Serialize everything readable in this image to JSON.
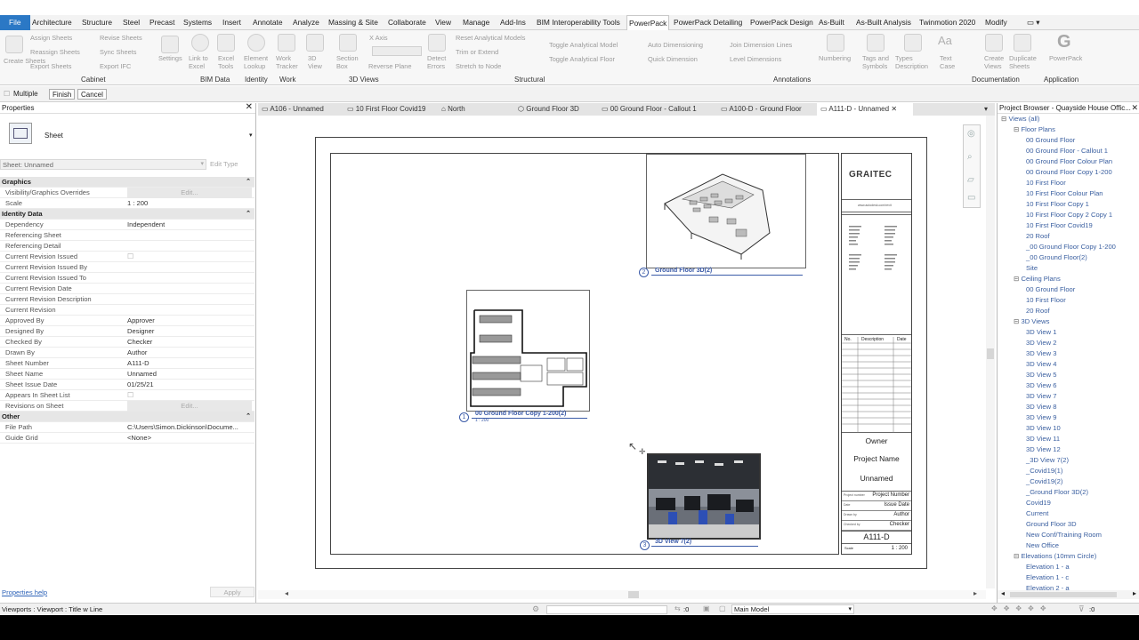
{
  "menu_tabs": [
    "File",
    "Architecture",
    "Structure",
    "Steel",
    "Precast",
    "Systems",
    "Insert",
    "Annotate",
    "Analyze",
    "Massing & Site",
    "Collaborate",
    "View",
    "Manage",
    "Add-Ins",
    "BIM Interoperability Tools",
    "PowerPack",
    "PowerPack Detailing",
    "PowerPack Design",
    "As-Built",
    "As-Built Analysis",
    "Twinmotion 2020",
    "Modify"
  ],
  "ribbon": {
    "cabinet_items": [
      "Assign Sheets",
      "Reassign Sheets",
      "Export Sheets",
      "Revise Sheets",
      "Sync Sheets",
      "Export IFC"
    ],
    "create_sheets": "Create Sheets",
    "settings": "Settings",
    "link_to_excel": "Link to Excel",
    "excel_tools": "Excel Tools",
    "element_lookup": "Element Lookup",
    "work_tracker": "Work Tracker",
    "view_3d": "3D View",
    "section_box": "Section Box",
    "x_axis": "X Axis",
    "reverse_plane": "Reverse Plane",
    "detect_errors": "Detect Errors",
    "reset_analytical": "Reset Analytical Models",
    "trim_extend": "Trim or Extend",
    "stretch_to_node": "Stretch to Node",
    "toggle_analytical_model": "Toggle Analytical Model",
    "toggle_analytical_floor": "Toggle Analytical Floor",
    "auto_dimensioning": "Auto Dimensioning",
    "quick_dimension": "Quick Dimension",
    "join_dimension_lines": "Join Dimension Lines",
    "level_dimensions": "Level Dimensions",
    "numbering": "Numbering",
    "tags_and_symbols": "Tags and Symbols",
    "types_description": "Types Description",
    "text_case": "Text Case",
    "create_views": "Create Views",
    "duplicate_sheets": "Duplicate Sheets",
    "powerpack": "PowerPack",
    "panels": [
      "Cabinet",
      "BIM Data",
      "Identity",
      "Work",
      "3D Views",
      "Structural",
      "Annotations",
      "Documentation",
      "Application"
    ]
  },
  "options": {
    "multiple": "Multiple",
    "finish": "Finish",
    "cancel": "Cancel"
  },
  "properties": {
    "title": "Properties",
    "type": "Sheet",
    "selector": "Sheet: Unnamed",
    "edit_type": "Edit Type",
    "rows": [
      {
        "k": "Graphics",
        "v": "",
        "g": true
      },
      {
        "k": "Visibility/Graphics Overrides",
        "v": "Edit..."
      },
      {
        "k": "Scale",
        "v": "1 : 200"
      },
      {
        "k": "Identity Data",
        "v": "",
        "g": true
      },
      {
        "k": "Dependency",
        "v": "Independent"
      },
      {
        "k": "Referencing Sheet",
        "v": ""
      },
      {
        "k": "Referencing Detail",
        "v": ""
      },
      {
        "k": "Current Revision Issued",
        "v": ""
      },
      {
        "k": "Current Revision Issued By",
        "v": ""
      },
      {
        "k": "Current Revision Issued To",
        "v": ""
      },
      {
        "k": "Current Revision Date",
        "v": ""
      },
      {
        "k": "Current Revision Description",
        "v": ""
      },
      {
        "k": "Current Revision",
        "v": ""
      },
      {
        "k": "Approved By",
        "v": "Approver"
      },
      {
        "k": "Designed By",
        "v": "Designer"
      },
      {
        "k": "Checked By",
        "v": "Checker"
      },
      {
        "k": "Drawn By",
        "v": "Author"
      },
      {
        "k": "Sheet Number",
        "v": "A111-D"
      },
      {
        "k": "Sheet Name",
        "v": "Unnamed"
      },
      {
        "k": "Sheet Issue Date",
        "v": "01/25/21"
      },
      {
        "k": "Appears In Sheet List",
        "v": ""
      },
      {
        "k": "Revisions on Sheet",
        "v": "Edit..."
      },
      {
        "k": "Other",
        "v": "",
        "g": true
      },
      {
        "k": "File Path",
        "v": "C:\\Users\\Simon.Dickinson\\Docume..."
      },
      {
        "k": "Guide Grid",
        "v": "<None>"
      }
    ],
    "help": "Properties help",
    "apply": "Apply"
  },
  "view_tabs": [
    "A106 - Unnamed",
    "10 First Floor Covid19",
    "North",
    "Ground Floor 3D",
    "00 Ground Floor - Callout 1",
    "A100-D - Ground Floor",
    "A111-D - Unnamed"
  ],
  "sheet": {
    "vp1_label": "00 Ground Floor Copy 1-200(2)",
    "vp1_num": "1",
    "vp1_scale": "1 : 200",
    "vp2_label": "Ground Floor 3D(2)",
    "vp2_num": "2",
    "vp3_label": "3D View 7(2)",
    "vp3_num": "3",
    "tb_logo": "GRAITEC",
    "tb_web": "www.autodesk.com/revit",
    "tb_rev_headers": [
      "No.",
      "Description",
      "Date"
    ],
    "tb_owner": "Owner",
    "tb_project": "Project Name",
    "tb_sheetname": "Unnamed",
    "tb_fields": [
      {
        "k": "Project number",
        "v": "Project Number"
      },
      {
        "k": "Date",
        "v": "Issue Date"
      },
      {
        "k": "Drawn by",
        "v": "Author"
      },
      {
        "k": "Checked by",
        "v": "Checker"
      }
    ],
    "tb_number": "A111-D",
    "tb_scale_k": "Scale",
    "tb_scale_v": "1 : 200"
  },
  "browser": {
    "title": "Project Browser - Quayside House Offic...",
    "rows": [
      {
        "t": "Views (all)",
        "l": 0,
        "h": true
      },
      {
        "t": "Floor Plans",
        "l": 1,
        "h": true
      },
      {
        "t": "00 Ground Floor",
        "l": 2
      },
      {
        "t": "00 Ground Floor - Callout 1",
        "l": 2
      },
      {
        "t": "00 Ground Floor Colour Plan",
        "l": 2
      },
      {
        "t": "00 Ground Floor Copy 1-200",
        "l": 2
      },
      {
        "t": "10 First Floor",
        "l": 2
      },
      {
        "t": "10 First Floor Colour Plan",
        "l": 2
      },
      {
        "t": "10 First Floor Copy 1",
        "l": 2
      },
      {
        "t": "10 First Floor Copy 2 Copy 1",
        "l": 2
      },
      {
        "t": "10 First Floor Covid19",
        "l": 2
      },
      {
        "t": "20 Roof",
        "l": 2
      },
      {
        "t": "_00 Ground Floor Copy 1-200",
        "l": 2
      },
      {
        "t": "_00 Ground Floor(2)",
        "l": 2
      },
      {
        "t": "Site",
        "l": 2
      },
      {
        "t": "Ceiling Plans",
        "l": 1,
        "h": true
      },
      {
        "t": "00 Ground Floor",
        "l": 2
      },
      {
        "t": "10 First Floor",
        "l": 2
      },
      {
        "t": "20 Roof",
        "l": 2
      },
      {
        "t": "3D Views",
        "l": 1,
        "h": true
      },
      {
        "t": "3D View 1",
        "l": 2
      },
      {
        "t": "3D View 2",
        "l": 2
      },
      {
        "t": "3D View 3",
        "l": 2
      },
      {
        "t": "3D View 4",
        "l": 2
      },
      {
        "t": "3D View 5",
        "l": 2
      },
      {
        "t": "3D View 6",
        "l": 2
      },
      {
        "t": "3D View 7",
        "l": 2
      },
      {
        "t": "3D View 8",
        "l": 2
      },
      {
        "t": "3D View 9",
        "l": 2
      },
      {
        "t": "3D View 10",
        "l": 2
      },
      {
        "t": "3D View 11",
        "l": 2
      },
      {
        "t": "3D View 12",
        "l": 2
      },
      {
        "t": "_3D View 7(2)",
        "l": 2
      },
      {
        "t": "_Covid19(1)",
        "l": 2
      },
      {
        "t": "_Covid19(2)",
        "l": 2
      },
      {
        "t": "_Ground Floor 3D(2)",
        "l": 2
      },
      {
        "t": "Covid19",
        "l": 2
      },
      {
        "t": "Current",
        "l": 2
      },
      {
        "t": "Ground Floor 3D",
        "l": 2
      },
      {
        "t": "New Conf/Training Room",
        "l": 2
      },
      {
        "t": "New Office",
        "l": 2
      },
      {
        "t": "Elevations (10mm Circle)",
        "l": 1,
        "h": true
      },
      {
        "t": "Elevation 1 - a",
        "l": 2
      },
      {
        "t": "Elevation 1 - c",
        "l": 2
      },
      {
        "t": "Elevation 2 - a",
        "l": 2
      }
    ]
  },
  "status": {
    "left": "Viewports : Viewport : Title w Line",
    "zero": ":0",
    "model": "Main Model",
    "filter": ":0"
  }
}
